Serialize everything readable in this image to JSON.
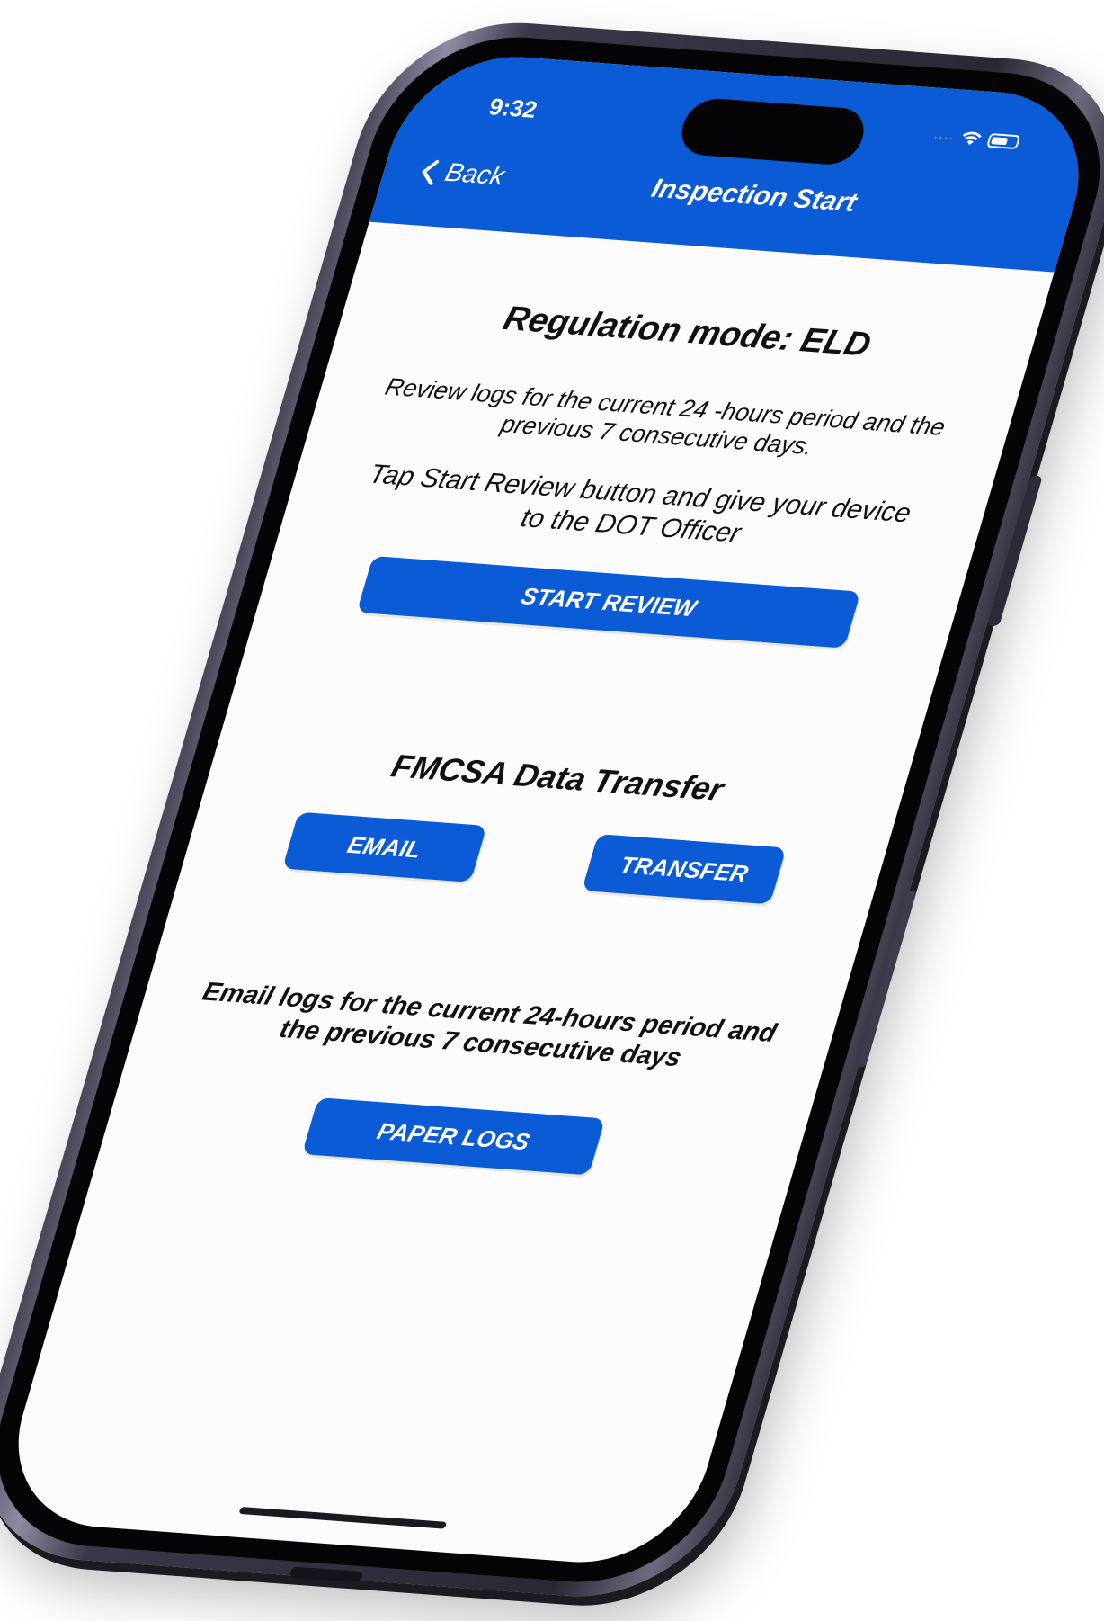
{
  "status_bar": {
    "time": "9:32"
  },
  "nav": {
    "back_label": "Back",
    "title": "Inspection Start"
  },
  "regulation": {
    "heading": "Regulation mode: ELD",
    "description": "Review logs for the current 24 -hours period and the previous 7 consecutive days.",
    "instruction": "Tap Start Review button and give your device to the DOT Officer",
    "start_review_label": "START REVIEW"
  },
  "transfer": {
    "heading": "FMCSA Data Transfer",
    "email_label": "EMAIL",
    "transfer_label": "TRANSFER",
    "email_note": "Email logs for the current 24-hours period and the previous 7 consecutive days",
    "paper_logs_label": "PAPER LOGS"
  },
  "colors": {
    "accent": "#0b5bd7",
    "screen_bg": "#fbfbfc",
    "frame": "#3b3849"
  },
  "icons": {
    "back": "chevron-left-icon",
    "wifi": "wifi-icon",
    "battery": "battery-icon"
  }
}
